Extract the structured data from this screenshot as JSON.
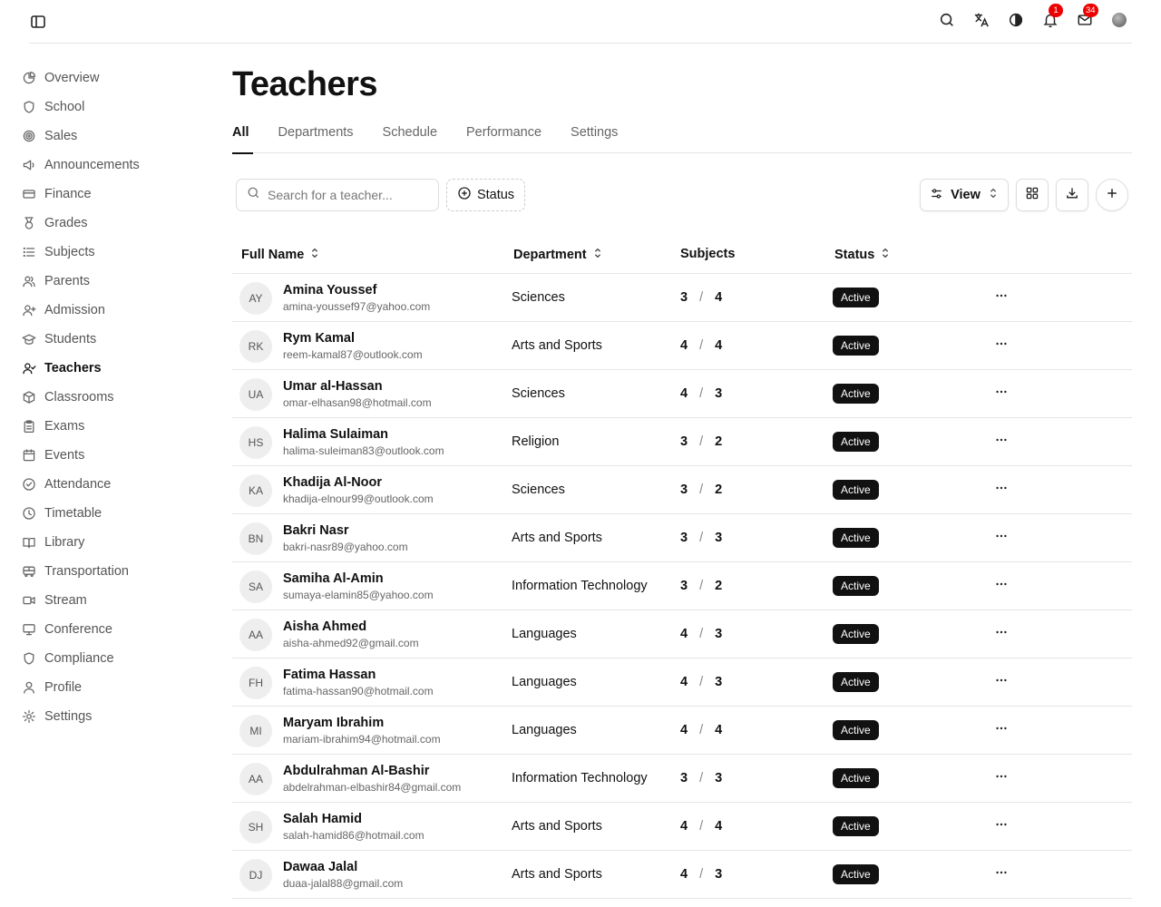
{
  "topbar": {
    "notifications_count": "1",
    "mail_count": "34"
  },
  "sidebar": {
    "items": [
      {
        "label": "Overview",
        "icon": "pie-chart-icon"
      },
      {
        "label": "School",
        "icon": "shield-icon"
      },
      {
        "label": "Sales",
        "icon": "target-icon"
      },
      {
        "label": "Announcements",
        "icon": "megaphone-icon"
      },
      {
        "label": "Finance",
        "icon": "credit-card-icon"
      },
      {
        "label": "Grades",
        "icon": "medal-icon"
      },
      {
        "label": "Subjects",
        "icon": "list-icon"
      },
      {
        "label": "Parents",
        "icon": "users-icon"
      },
      {
        "label": "Admission",
        "icon": "user-plus-icon"
      },
      {
        "label": "Students",
        "icon": "graduation-cap-icon"
      },
      {
        "label": "Teachers",
        "icon": "user-check-icon",
        "active": true
      },
      {
        "label": "Classrooms",
        "icon": "box-icon"
      },
      {
        "label": "Exams",
        "icon": "clipboard-icon"
      },
      {
        "label": "Events",
        "icon": "calendar-icon"
      },
      {
        "label": "Attendance",
        "icon": "check-circle-icon"
      },
      {
        "label": "Timetable",
        "icon": "clock-icon"
      },
      {
        "label": "Library",
        "icon": "book-open-icon"
      },
      {
        "label": "Transportation",
        "icon": "bus-icon"
      },
      {
        "label": "Stream",
        "icon": "video-icon"
      },
      {
        "label": "Conference",
        "icon": "monitor-icon"
      },
      {
        "label": "Compliance",
        "icon": "shield-icon"
      },
      {
        "label": "Profile",
        "icon": "user-icon"
      },
      {
        "label": "Settings",
        "icon": "gear-icon"
      }
    ]
  },
  "page": {
    "title": "Teachers"
  },
  "tabs": [
    "All",
    "Departments",
    "Schedule",
    "Performance",
    "Settings"
  ],
  "toolbar": {
    "search_placeholder": "Search for a teacher...",
    "status_label": "Status",
    "view_label": "View"
  },
  "table": {
    "headers": {
      "name": "Full Name",
      "department": "Department",
      "subjects": "Subjects",
      "status": "Status"
    },
    "rows": [
      {
        "initials": "AY",
        "name": "Amina Youssef",
        "email": "amina-youssef97@yahoo.com",
        "department": "Sciences",
        "subj_a": "3",
        "subj_b": "4",
        "status": "Active"
      },
      {
        "initials": "RK",
        "name": "Rym Kamal",
        "email": "reem-kamal87@outlook.com",
        "department": "Arts and Sports",
        "subj_a": "4",
        "subj_b": "4",
        "status": "Active"
      },
      {
        "initials": "UA",
        "name": "Umar al-Hassan",
        "email": "omar-elhasan98@hotmail.com",
        "department": "Sciences",
        "subj_a": "4",
        "subj_b": "3",
        "status": "Active"
      },
      {
        "initials": "HS",
        "name": "Halima Sulaiman",
        "email": "halima-suleiman83@outlook.com",
        "department": "Religion",
        "subj_a": "3",
        "subj_b": "2",
        "status": "Active"
      },
      {
        "initials": "KA",
        "name": "Khadija Al-Noor",
        "email": "khadija-elnour99@outlook.com",
        "department": "Sciences",
        "subj_a": "3",
        "subj_b": "2",
        "status": "Active"
      },
      {
        "initials": "BN",
        "name": "Bakri Nasr",
        "email": "bakri-nasr89@yahoo.com",
        "department": "Arts and Sports",
        "subj_a": "3",
        "subj_b": "3",
        "status": "Active"
      },
      {
        "initials": "SA",
        "name": "Samiha Al-Amin",
        "email": "sumaya-elamin85@yahoo.com",
        "department": "Information Technology",
        "subj_a": "3",
        "subj_b": "2",
        "status": "Active"
      },
      {
        "initials": "AA",
        "name": "Aisha Ahmed",
        "email": "aisha-ahmed92@gmail.com",
        "department": "Languages",
        "subj_a": "4",
        "subj_b": "3",
        "status": "Active"
      },
      {
        "initials": "FH",
        "name": "Fatima Hassan",
        "email": "fatima-hassan90@hotmail.com",
        "department": "Languages",
        "subj_a": "4",
        "subj_b": "3",
        "status": "Active"
      },
      {
        "initials": "MI",
        "name": "Maryam Ibrahim",
        "email": "mariam-ibrahim94@hotmail.com",
        "department": "Languages",
        "subj_a": "4",
        "subj_b": "4",
        "status": "Active"
      },
      {
        "initials": "AA",
        "name": "Abdulrahman Al-Bashir",
        "email": "abdelrahman-elbashir84@gmail.com",
        "department": "Information Technology",
        "subj_a": "3",
        "subj_b": "3",
        "status": "Active"
      },
      {
        "initials": "SH",
        "name": "Salah Hamid",
        "email": "salah-hamid86@hotmail.com",
        "department": "Arts and Sports",
        "subj_a": "4",
        "subj_b": "4",
        "status": "Active"
      },
      {
        "initials": "DJ",
        "name": "Dawaa Jalal",
        "email": "duaa-jalal88@gmail.com",
        "department": "Arts and Sports",
        "subj_a": "4",
        "subj_b": "3",
        "status": "Active"
      }
    ]
  }
}
